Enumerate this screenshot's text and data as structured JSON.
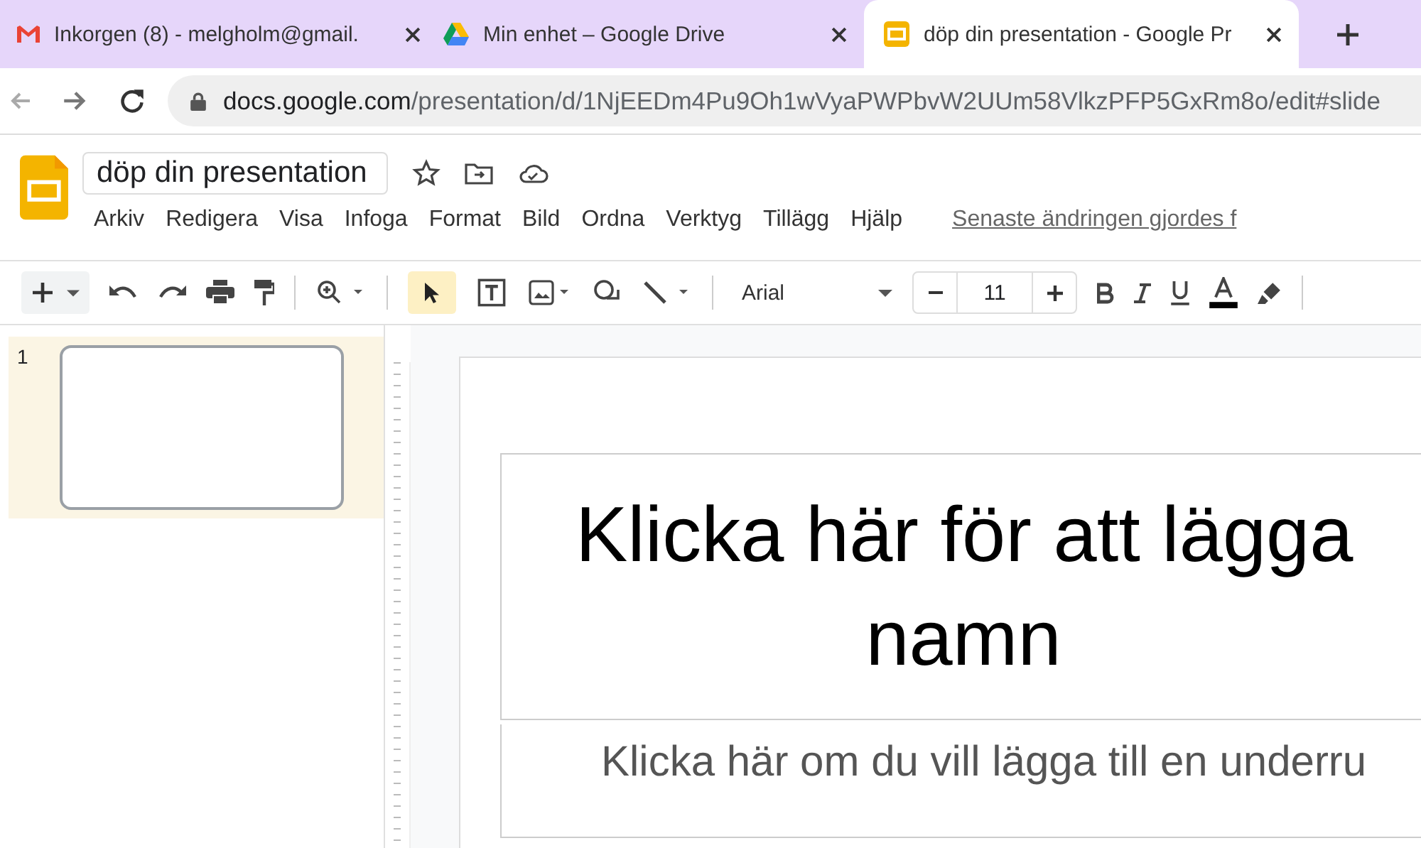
{
  "browser": {
    "tabs": [
      {
        "title": "Inkorgen (8) - melgholm@gmail.",
        "kind": "mail",
        "selected": false
      },
      {
        "title": "Min enhet – Google Drive",
        "kind": "drive",
        "selected": false
      },
      {
        "title": "döp din presentation - Google Pr",
        "kind": "slides",
        "selected": true
      }
    ],
    "url_host": "docs.google.com",
    "url_path": "/presentation/d/1NjEEDm4Pu9Oh1wVyaPWPbvW2UUm58VlkzPFP5GxRm8o/edit#slide"
  },
  "document": {
    "title": "döp din presentation",
    "menu": [
      "Arkiv",
      "Redigera",
      "Visa",
      "Infoga",
      "Format",
      "Bild",
      "Ordna",
      "Verktyg",
      "Tillägg",
      "Hjälp"
    ],
    "last_edit": "Senaste ändringen gjordes f"
  },
  "toolbar": {
    "pointer_selected": true,
    "font": "Arial",
    "font_size": "11"
  },
  "slides": [
    {
      "number": "1",
      "selected": true
    }
  ],
  "slide": {
    "title_lines": [
      "Klicka här för att lägga",
      "namn"
    ],
    "subtitle": "Klicka här om du vill lägga till en underru"
  }
}
